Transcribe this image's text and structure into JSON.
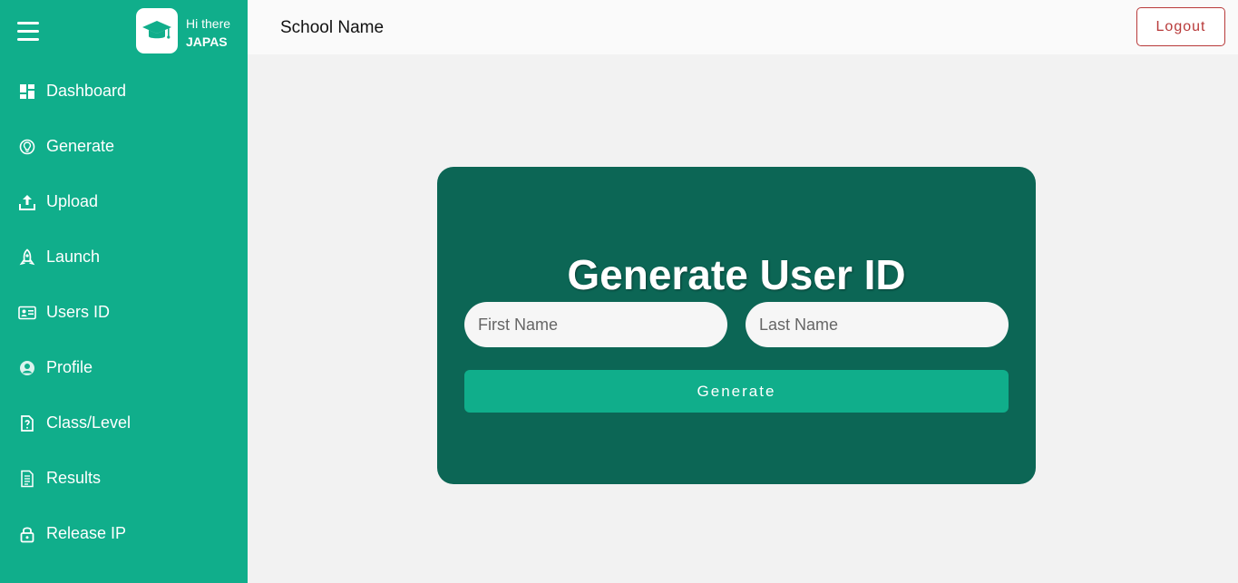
{
  "sidebar": {
    "greeting": "Hi there",
    "username": "JAPAS",
    "items": [
      {
        "label": "Dashboard",
        "icon": "dashboard-icon"
      },
      {
        "label": "Generate",
        "icon": "bulb-icon"
      },
      {
        "label": "Upload",
        "icon": "upload-icon"
      },
      {
        "label": "Launch",
        "icon": "rocket-icon"
      },
      {
        "label": "Users ID",
        "icon": "id-card-icon"
      },
      {
        "label": "Profile",
        "icon": "user-circle-icon"
      },
      {
        "label": "Class/Level",
        "icon": "question-file-icon"
      },
      {
        "label": "Results",
        "icon": "document-icon"
      },
      {
        "label": "Release IP",
        "icon": "lock-icon"
      }
    ]
  },
  "header": {
    "school_name": "School Name",
    "logout_label": "Logout"
  },
  "main": {
    "title": "Generate User ID",
    "first_name_placeholder": "First Name",
    "last_name_placeholder": "Last Name",
    "generate_label": "Generate"
  },
  "colors": {
    "sidebar": "#10ae8b",
    "card": "#0c6655",
    "logout": "#b83a3a"
  }
}
